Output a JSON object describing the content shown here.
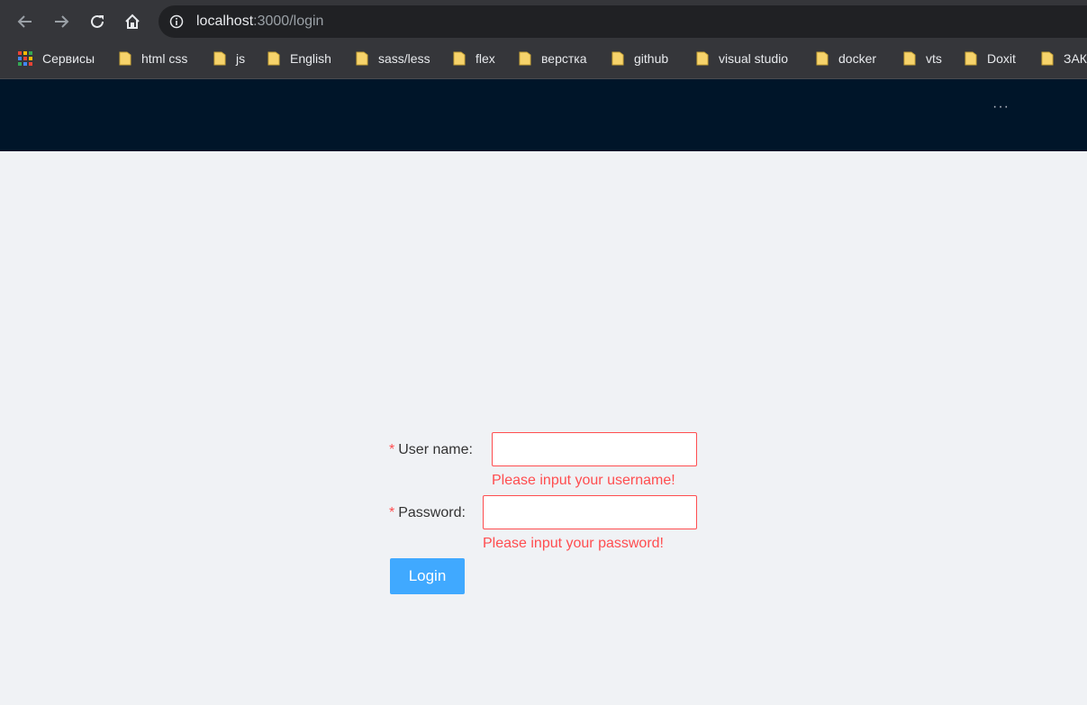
{
  "browser": {
    "url_host": "localhost",
    "url_path": ":3000/login",
    "icons": [
      "back-icon",
      "forward-icon",
      "reload-icon",
      "home-icon",
      "info-icon"
    ],
    "bookmarks": [
      {
        "label": "Сервисы",
        "icon": "apps-icon"
      },
      {
        "label": "html css",
        "icon": "folder-icon"
      },
      {
        "label": "js",
        "icon": "folder-icon"
      },
      {
        "label": "English",
        "icon": "folder-icon"
      },
      {
        "label": "sass/less",
        "icon": "folder-icon"
      },
      {
        "label": "flex",
        "icon": "folder-icon"
      },
      {
        "label": "верстка",
        "icon": "folder-icon"
      },
      {
        "label": "github",
        "icon": "folder-icon"
      },
      {
        "label": "visual studio",
        "icon": "folder-icon"
      },
      {
        "label": "docker",
        "icon": "folder-icon"
      },
      {
        "label": "vts",
        "icon": "folder-icon"
      },
      {
        "label": "Doxit",
        "icon": "folder-icon"
      },
      {
        "label": "ЗАК",
        "icon": "folder-icon"
      }
    ]
  },
  "header": {
    "menu_overflow": "···",
    "background_color": "#001529"
  },
  "form": {
    "username_label": "User name",
    "username_required": "*",
    "username_value": "",
    "username_error": "Please input your username!",
    "password_label": "Password",
    "password_required": "*",
    "password_value": "",
    "password_error": "Please input your password!",
    "login_label": "Login",
    "error_color": "#ff4d4f",
    "primary_color": "#40a9ff"
  }
}
